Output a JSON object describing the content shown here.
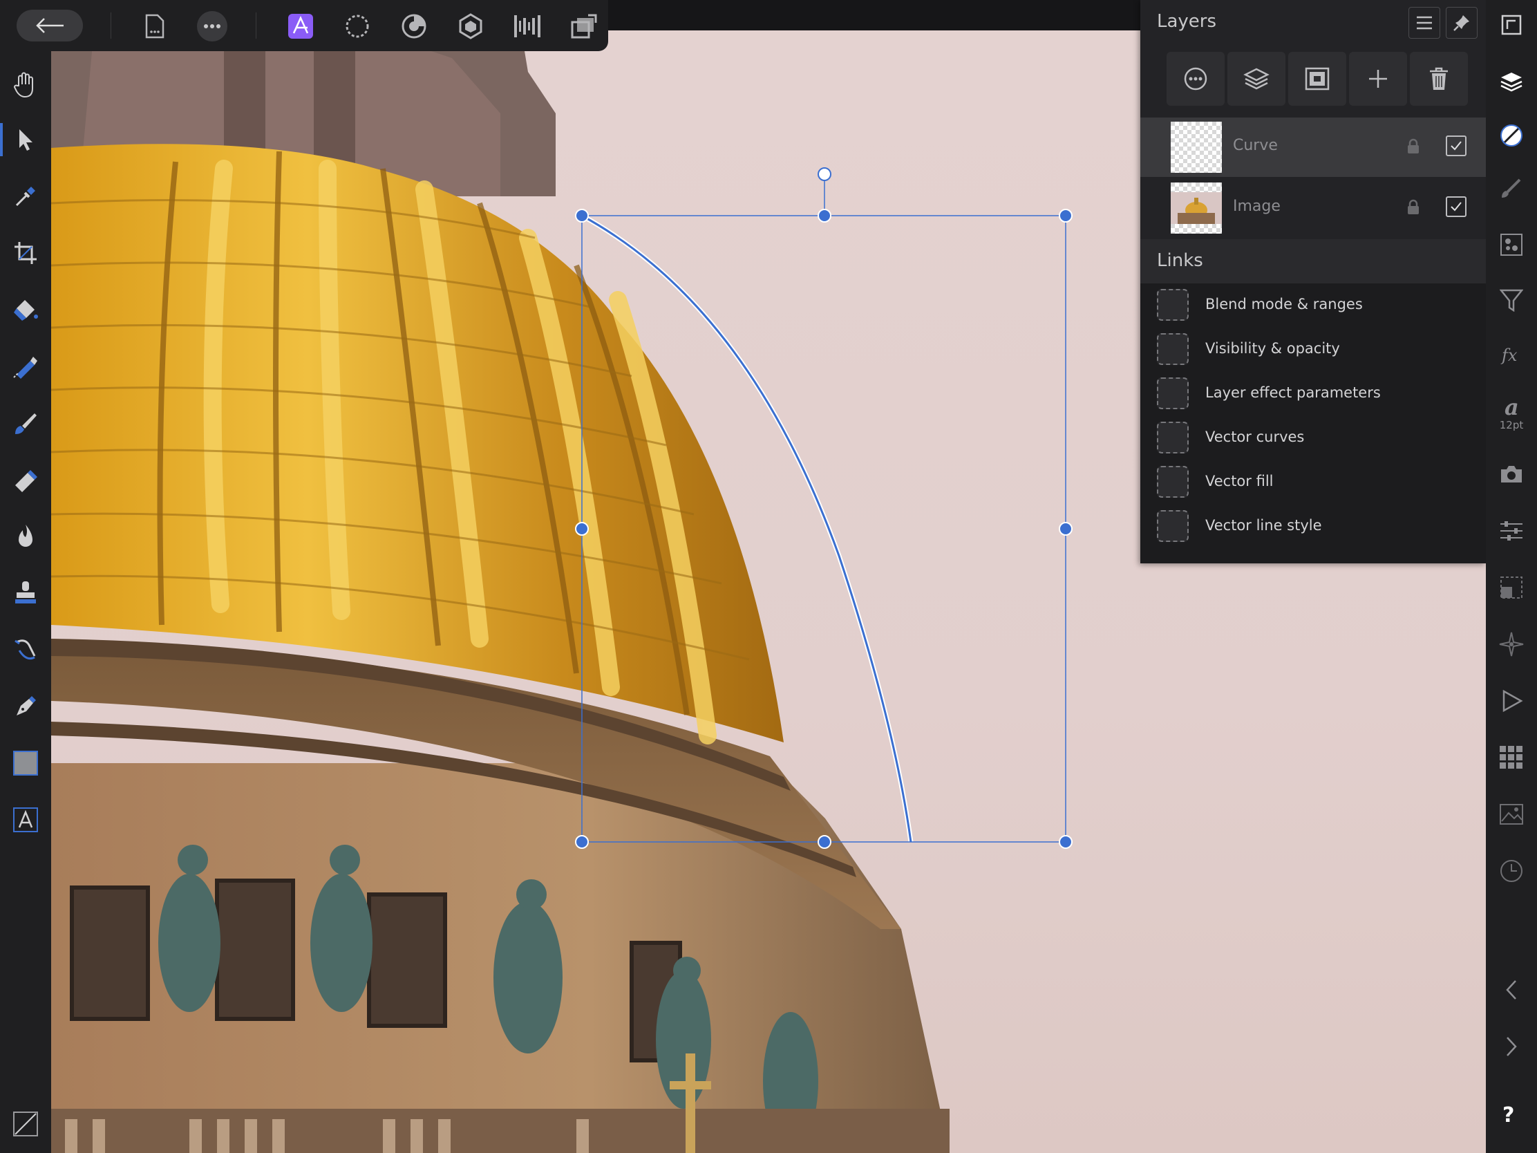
{
  "toolbar": {
    "back_icon": "back-arrow-icon",
    "items": [
      "document-icon",
      "more-icon",
      "photo-persona-icon",
      "liquify-persona-icon",
      "develop-persona-icon",
      "tone-mapping-persona-icon",
      "export-persona-icon",
      "slices-icon"
    ]
  },
  "layers_panel": {
    "title": "Layers",
    "actions": [
      "layer-options-icon",
      "layer-stack-icon",
      "mask-icon",
      "add-layer-icon",
      "delete-layer-icon"
    ],
    "layers": [
      {
        "name": "Curve",
        "selected": true,
        "locked": false,
        "visible": true
      },
      {
        "name": "Image",
        "selected": false,
        "locked": false,
        "visible": true
      }
    ]
  },
  "links_panel": {
    "title": "Links",
    "items": [
      "Blend mode & ranges",
      "Visibility & opacity",
      "Layer effect parameters",
      "Vector curves",
      "Vector fill",
      "Vector line style"
    ]
  },
  "right_bar": {
    "font_size": "12pt",
    "help": "?"
  },
  "colors": {
    "selection": "#3b6fd0",
    "accent_persona": "#8a5cf6",
    "panel_bg": "#232326",
    "toolbar_bg": "#1f1f21"
  }
}
